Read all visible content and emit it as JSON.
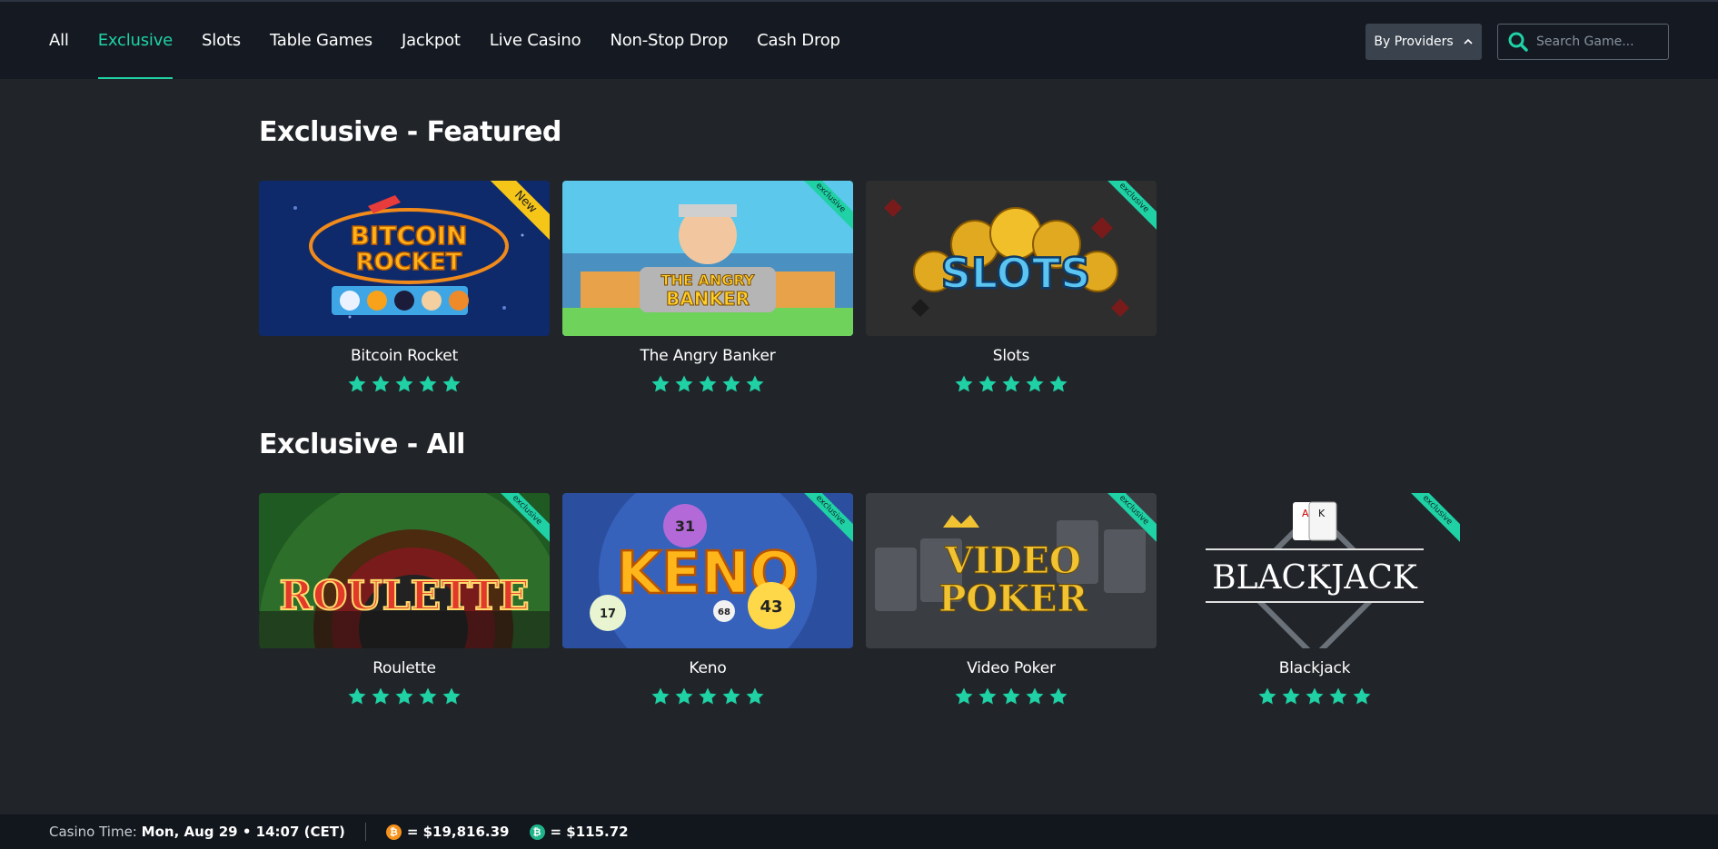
{
  "nav": {
    "items": [
      {
        "label": "All",
        "active": false
      },
      {
        "label": "Exclusive",
        "active": true
      },
      {
        "label": "Slots",
        "active": false
      },
      {
        "label": "Table Games",
        "active": false
      },
      {
        "label": "Jackpot",
        "active": false
      },
      {
        "label": "Live Casino",
        "active": false
      },
      {
        "label": "Non-Stop Drop",
        "active": false
      },
      {
        "label": "Cash Drop",
        "active": false
      }
    ],
    "providers_label": "By Providers",
    "search_placeholder": "Search Game..."
  },
  "sections": [
    {
      "title": "Exclusive - Featured",
      "games": [
        {
          "name": "Bitcoin Rocket",
          "art_text": [
            "BITCOIN",
            "ROCKET"
          ],
          "badge": "New",
          "rating": 5
        },
        {
          "name": "The Angry Banker",
          "art_text": [
            "THE ANGRY",
            "BANKER"
          ],
          "badge": "exclusive",
          "rating": 5
        },
        {
          "name": "Slots",
          "art_text": [
            "SLOTS"
          ],
          "badge": "exclusive",
          "rating": 5
        }
      ]
    },
    {
      "title": "Exclusive - All",
      "games": [
        {
          "name": "Roulette",
          "art_text": [
            "ROULETTE"
          ],
          "badge": "exclusive",
          "rating": 5
        },
        {
          "name": "Keno",
          "art_text": [
            "KENO",
            "31",
            "17",
            "68",
            "43"
          ],
          "badge": "exclusive",
          "rating": 5
        },
        {
          "name": "Video Poker",
          "art_text": [
            "VIDEO",
            "POKER"
          ],
          "badge": "exclusive",
          "rating": 5
        },
        {
          "name": "Blackjack",
          "art_text": [
            "BLACKJACK"
          ],
          "badge": "exclusive",
          "rating": 5
        }
      ]
    }
  ],
  "footer": {
    "casino_time_label": "Casino Time:",
    "casino_time_value": "Mon, Aug 29 • 14:07 (CET)",
    "btc_rate": "= $19,816.39",
    "bch_rate": "= $115.72"
  },
  "colors": {
    "accent": "#1fd1a5",
    "background": "#212529",
    "topbar": "#151a22",
    "new_badge": "#f5c518",
    "btc_coin": "#f7931a"
  }
}
